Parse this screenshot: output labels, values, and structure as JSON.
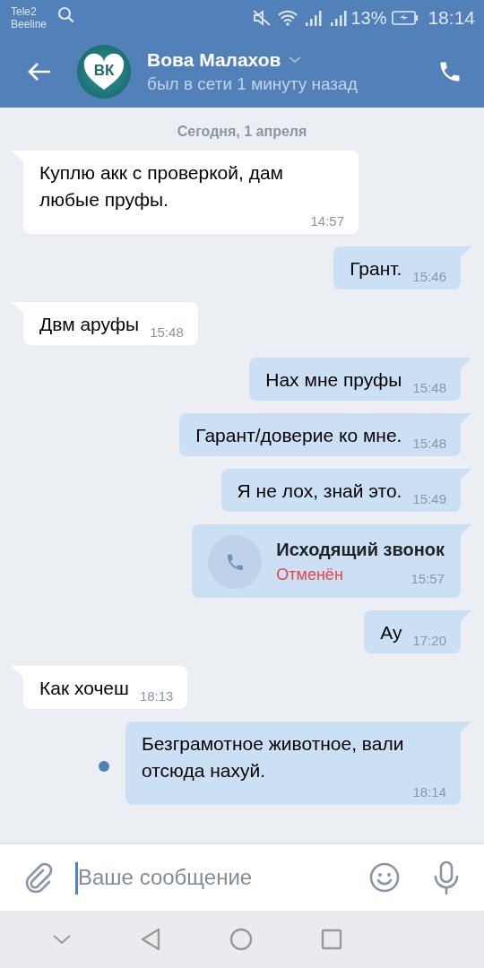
{
  "status_bar": {
    "carriers": [
      "Tele2",
      "Beeline"
    ],
    "battery_percent": "13%",
    "time": "18:14"
  },
  "header": {
    "name": "Вова Малахов",
    "status": "был в сети 1 минуту назад",
    "avatar_text": "ВК"
  },
  "date_divider": "Сегодня, 1 апреля",
  "messages": [
    {
      "kind": "text",
      "outgoing": false,
      "text": "Куплю акк с проверкой, дам любые пруфы.",
      "time": "14:57",
      "unread": false
    },
    {
      "kind": "text",
      "outgoing": true,
      "text": "Грант.",
      "time": "15:46",
      "unread": false
    },
    {
      "kind": "text",
      "outgoing": false,
      "text": "Двм аруфы",
      "time": "15:48",
      "unread": false
    },
    {
      "kind": "text",
      "outgoing": true,
      "text": "Нах мне пруфы",
      "time": "15:48",
      "unread": false
    },
    {
      "kind": "text",
      "outgoing": true,
      "text": "Гарант/доверие ко мне.",
      "time": "15:48",
      "unread": false
    },
    {
      "kind": "text",
      "outgoing": true,
      "text": "Я не лох, знай это.",
      "time": "15:49",
      "unread": false
    },
    {
      "kind": "call",
      "outgoing": true,
      "text": "Исходящий звонок",
      "status": "Отменён",
      "time": "15:57",
      "unread": false
    },
    {
      "kind": "text",
      "outgoing": true,
      "text": "Ау",
      "time": "17:20",
      "unread": false
    },
    {
      "kind": "text",
      "outgoing": false,
      "text": "Как хочеш",
      "time": "18:13",
      "unread": false
    },
    {
      "kind": "text",
      "outgoing": true,
      "text": "Безграмотное животное, вали отсюда нахуй.",
      "time": "18:14",
      "unread": true
    }
  ],
  "composer": {
    "placeholder": "Ваше сообщение"
  }
}
